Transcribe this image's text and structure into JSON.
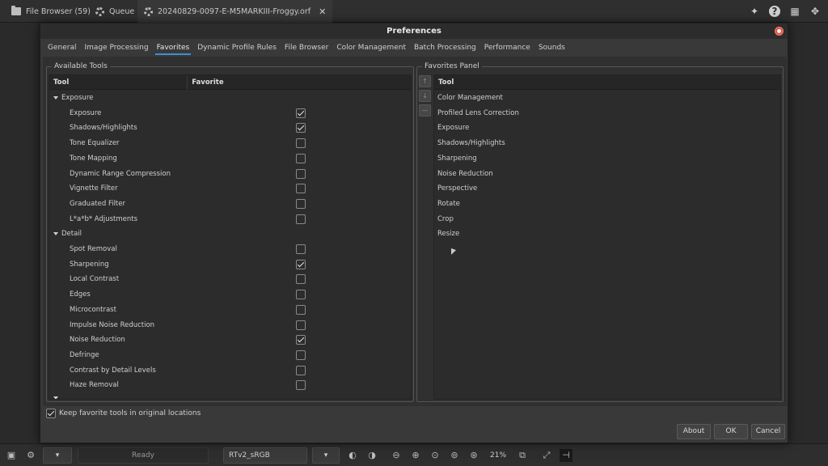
{
  "app_tabs": [
    {
      "label": "File Browser (59)"
    },
    {
      "label": "Queue"
    },
    {
      "label": "20240829-0097-E-M5MARKIII-Froggy.orf"
    }
  ],
  "dialog": {
    "title": "Preferences",
    "tabs": [
      "General",
      "Image Processing",
      "Favorites",
      "Dynamic Profile Rules",
      "File Browser",
      "Color Management",
      "Batch Processing",
      "Performance",
      "Sounds"
    ],
    "active_tab": "Favorites",
    "available_tools": {
      "legend": "Available Tools",
      "col_tool": "Tool",
      "col_favorite": "Favorite",
      "groups": [
        {
          "name": "Exposure",
          "tools": [
            {
              "name": "Exposure",
              "favorite": true
            },
            {
              "name": "Shadows/Highlights",
              "favorite": true
            },
            {
              "name": "Tone Equalizer",
              "favorite": false
            },
            {
              "name": "Tone Mapping",
              "favorite": false
            },
            {
              "name": "Dynamic Range Compression",
              "favorite": false
            },
            {
              "name": "Vignette Filter",
              "favorite": false
            },
            {
              "name": "Graduated Filter",
              "favorite": false
            },
            {
              "name": "L*a*b* Adjustments",
              "favorite": false
            }
          ]
        },
        {
          "name": "Detail",
          "tools": [
            {
              "name": "Spot Removal",
              "favorite": false
            },
            {
              "name": "Sharpening",
              "favorite": true
            },
            {
              "name": "Local Contrast",
              "favorite": false
            },
            {
              "name": "Edges",
              "favorite": false
            },
            {
              "name": "Microcontrast",
              "favorite": false
            },
            {
              "name": "Impulse Noise Reduction",
              "favorite": false
            },
            {
              "name": "Noise Reduction",
              "favorite": true
            },
            {
              "name": "Defringe",
              "favorite": false
            },
            {
              "name": "Contrast by Detail Levels",
              "favorite": false
            },
            {
              "name": "Haze Removal",
              "favorite": false
            }
          ]
        }
      ]
    },
    "favorites_panel": {
      "legend": "Favorites Panel",
      "col_tool": "Tool",
      "items": [
        "Color Management",
        "Profiled Lens Correction",
        "Exposure",
        "Shadows/Highlights",
        "Sharpening",
        "Noise Reduction",
        "Perspective",
        "Rotate",
        "Crop",
        "Resize"
      ]
    },
    "keep_label": "Keep favorite tools in original locations",
    "keep_checked": true,
    "buttons": {
      "about": "About",
      "ok": "OK",
      "cancel": "Cancel"
    }
  },
  "bottom_bar": {
    "status": "Ready",
    "profile": "RTv2_sRGB",
    "zoom": "21%"
  },
  "colors": {
    "accent": "#3d8fd6",
    "close": "#e0523f"
  }
}
